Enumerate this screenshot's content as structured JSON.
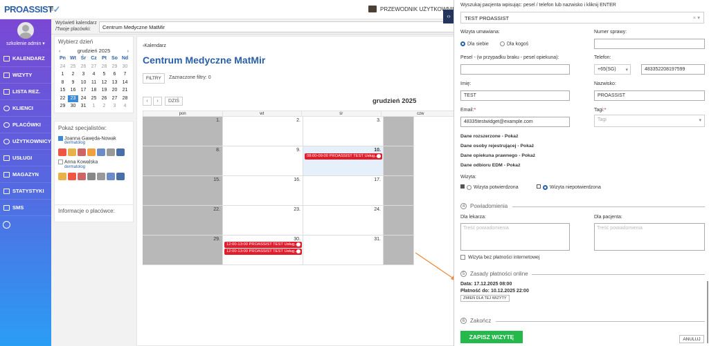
{
  "app": {
    "logo": "PROASSIST",
    "guide_label": "PRZEWODNIK UŻYTKOWNIK"
  },
  "user": {
    "name": "szkolenie admin ▾"
  },
  "nav": {
    "items": [
      "KALENDARZ",
      "WIZYTY",
      "LISTA REZ.",
      "KLIENCI",
      "PLACÓWKI",
      "UŻYTKOWNICY",
      "USŁUGI",
      "MAGAZYN",
      "STATYSTYKI",
      "SMS"
    ]
  },
  "header": {
    "label_line1": "Wyświetl kalendarz",
    "label_line2": "/Twoje placówki:",
    "selected_place": "Centrum Medyczne MatMir"
  },
  "minical": {
    "title": "Wybierz dzień",
    "month": "grudzień 2025",
    "prev": "‹",
    "next": "›",
    "weekdays": [
      "Pn",
      "Wt",
      "Śr",
      "Cz",
      "Pt",
      "So",
      "Nd"
    ],
    "days": [
      "24",
      "25",
      "26",
      "27",
      "28",
      "29",
      "30",
      "1",
      "2",
      "3",
      "4",
      "5",
      "6",
      "7",
      "8",
      "9",
      "10",
      "11",
      "12",
      "13",
      "14",
      "15",
      "16",
      "17",
      "18",
      "19",
      "20",
      "21",
      "22",
      "23",
      "24",
      "25",
      "26",
      "27",
      "28",
      "29",
      "30",
      "31",
      "1",
      "2",
      "3",
      "4"
    ],
    "other_month_idx": [
      0,
      1,
      2,
      3,
      4,
      5,
      6,
      38,
      39,
      40,
      41
    ],
    "selected_idx": 29
  },
  "specialists": {
    "title": "Pokaż specjalistów:",
    "list": [
      {
        "name": "Joanna Gawęda-Nowak",
        "role": "dermatolog",
        "checked": true
      },
      {
        "name": "Anna Kowalska",
        "role": "dermatolog",
        "checked": false
      }
    ]
  },
  "info": {
    "title": "Informacje o placówce:"
  },
  "calendar": {
    "back": "‹Kalendarz",
    "title": "Centrum Medyczne MatMir",
    "filter_btn": "FILTRY",
    "filters_label": "Zaznaczone filtry: 0",
    "prev": "‹",
    "next": "›",
    "today": "DZIŚ",
    "month": "grudzień 2025",
    "columns": [
      "pon",
      "wt",
      "śr",
      "czw"
    ],
    "weeks": [
      [
        "1.",
        "2.",
        "3.",
        ""
      ],
      [
        "8.",
        "9.",
        "10.",
        ""
      ],
      [
        "15.",
        "16.",
        "17.",
        ""
      ],
      [
        "22.",
        "23.",
        "24.",
        ""
      ],
      [
        "29.",
        "30.",
        "31.",
        ""
      ]
    ],
    "events": [
      {
        "text": "08:00-09:00 PROASSIST TEST Usług..."
      },
      {
        "text": "12:00-13:00 PROASSIST TEST Usług..."
      },
      {
        "text": "12:00-13:00 PROASSIST TEST Usług..."
      }
    ]
  },
  "form": {
    "search_label": "Wyszukaj pacjenta wpisując: pesel / telefon lub nazwisko i kliknij ENTER",
    "patient": "TEST PROASSIST",
    "visit_for_label": "Wizyta umawiana:",
    "visit_for_self": "Dla siebie",
    "visit_for_other": "Dla kogoś",
    "case_label": "Numer sprawy:",
    "pesel_label": "Pesel - (w przypadku braku - pesel opiekuna):",
    "phone_label": "Telefon:",
    "phone_prefix": "+65(SG)",
    "phone_value": "483352208197599",
    "name_label": "Imię:",
    "name_value": "TEST",
    "surname_label": "Nazwisko:",
    "surname_value": "PROASSIST",
    "email_label": "Email:",
    "email_value": "48335testwidget@example.com",
    "tags_label": "Tagi:",
    "tags_placeholder": "Tagi",
    "links": [
      "Dane rozszerzone - Pokaż",
      "Dane osoby rejestrującej - Pokaż",
      "Dane opiekuna prawnego - Pokaż",
      "Dane odbioru EDM - Pokaż"
    ],
    "visit_label": "Wizyta:",
    "visit_confirmed": "Wizyta potwierdzona",
    "visit_unconfirmed": "Wizyta niepotwierdzona",
    "sec4": "Powiadomienia",
    "sec4_num": "4",
    "doctor_label": "Dla lekarza:",
    "patient_label": "Dla pacjenta:",
    "ta_placeholder": "Treść powiadomienia",
    "no_payment": "Wizyta bez płatności internetowej",
    "sec5": "Zasady płatności online",
    "sec5_num": "5",
    "date_line": "Data: 17.12.2025 08:00",
    "pay_line": "Płatność do: 10.12.2025 22:00",
    "change_btn": "ZMIEŃ DLA TEJ WIZYTY",
    "sec6": "Zakończ",
    "sec6_num": "6",
    "save_btn": "ZAPISZ WIZYTĘ",
    "cancel_btn": "ANULUJ"
  },
  "colors": {
    "accent": "#2a5fa8",
    "event": "#e11c2b",
    "save": "#25b84a"
  }
}
